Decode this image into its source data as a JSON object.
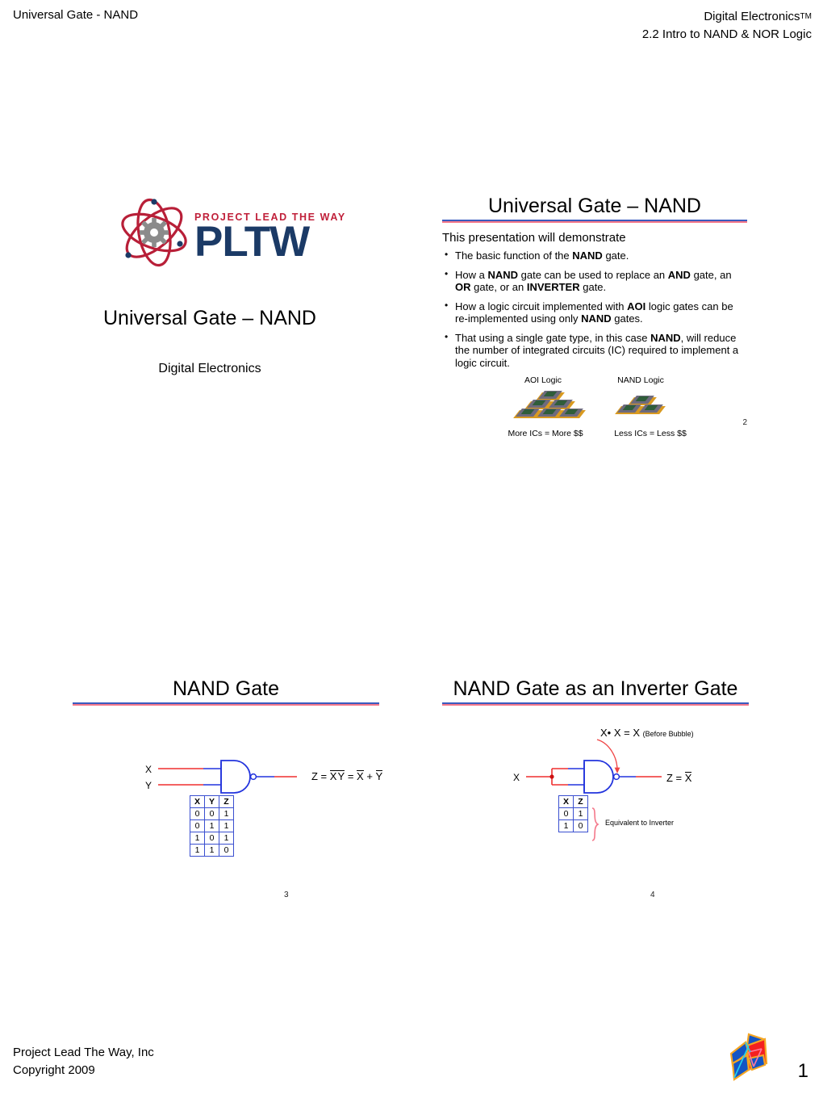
{
  "header": {
    "left": "Universal Gate - NAND",
    "right_line1": "Digital Electronics",
    "right_tm": "TM",
    "right_line2": "2.2 Intro to NAND & NOR Logic"
  },
  "slide1": {
    "logo": {
      "tagline": "PROJECT LEAD THE WAY",
      "wordmark": "PLTW",
      "atom_color": "#b81f38",
      "gear_color": "#8b8b8b",
      "tagline_color": "#c0203a",
      "wordmark_color": "#1b3a66"
    },
    "title": "Universal Gate – NAND",
    "subtitle": "Digital Electronics"
  },
  "slide2": {
    "title": "Universal Gate – NAND",
    "lead": "This presentation will demonstrate",
    "bullets": [
      "The basic function of the NAND gate.",
      "How a NAND gate can be used to replace an AND gate, an OR gate, or an INVERTER gate.",
      "How a logic circuit implemented with AOI logic gates can be re-implemented using only NAND gates.",
      "That using a single gate type, in this case NAND, will reduce the number of integrated circuits (IC) required to implement a logic circuit."
    ],
    "ic_left_caption_top": "AOI Logic",
    "ic_right_caption_top": "NAND Logic",
    "ic_left_caption_bottom": "More ICs = More $$",
    "ic_right_caption_bottom": "Less ICs = Less $$",
    "ic_left_count": 6,
    "ic_right_count": 3,
    "page_number": "2"
  },
  "slide3": {
    "title": "NAND Gate",
    "input_x": "X",
    "input_y": "Y",
    "equation": "Z = XY = X + Y",
    "truth_table": {
      "headers": [
        "X",
        "Y",
        "Z"
      ],
      "rows": [
        [
          "0",
          "0",
          "1"
        ],
        [
          "0",
          "1",
          "1"
        ],
        [
          "1",
          "0",
          "1"
        ],
        [
          "1",
          "1",
          "0"
        ]
      ]
    },
    "page_number": "3"
  },
  "slide4": {
    "title": "NAND Gate as an Inverter Gate",
    "input_x": "X",
    "annotation": "X• X = X",
    "annotation_note": "(Before Bubble)",
    "equation": "Z = X",
    "truth_table": {
      "headers": [
        "X",
        "Z"
      ],
      "rows": [
        [
          "0",
          "1"
        ],
        [
          "1",
          "0"
        ]
      ]
    },
    "brace_label": "Equivalent to Inverter",
    "page_number": "4"
  },
  "footer": {
    "line1": "Project Lead The Way, Inc",
    "line2": "Copyright 2009",
    "page_number": "1"
  },
  "colors": {
    "rule_blue": "#3a5bbf",
    "rule_red": "#f4788a",
    "wire_red": "#ef2f2f",
    "wire_blue": "#2233dd",
    "table_border": "#3a4fd0"
  }
}
